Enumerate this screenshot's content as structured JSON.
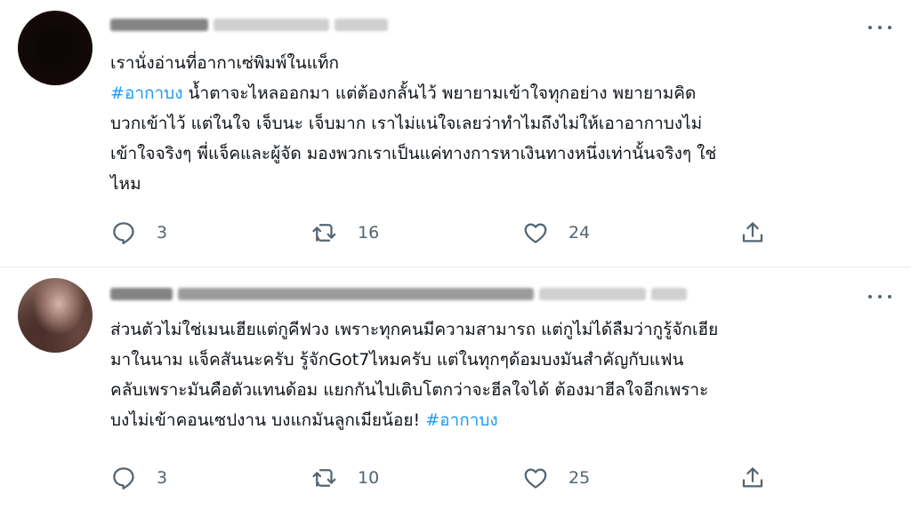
{
  "tweets": [
    {
      "text_lines": [
        [
          "เรานั่งอ่านที่อากาเซ่พิมพ์ในแท็ก"
        ],
        [
          "#อากาบง",
          " น้ำตาจะไหลออกมา แต่ต้องกลั้นไว้ พยายามเข้าใจทุกอย่าง พยายามคิด"
        ],
        [
          "บวกเข้าไว้ แต่ในใจ เจ็บนะ เจ็บมาก เราไม่แน่ใจเลยว่าทำไมถึงไม่ให้เอาอากาบงไม่"
        ],
        [
          "เข้าใจจริงๆ พี่แจ็คและผู้จัด มองพวกเราเป็นแค่ทางการหาเงินทางหนึ่งเท่านั้นจริงๆ ใช่"
        ],
        [
          "ไหม"
        ]
      ],
      "hashtag": "#อากาบง",
      "line1": "เรานั่งอ่านที่อากาเซ่พิมพ์ในแท็ก",
      "line2_rest": " น้ำตาจะไหลออกมา แต่ต้องกลั้นไว้ พยายามเข้าใจทุกอย่าง พยายามคิด",
      "line3": "บวกเข้าไว้ แต่ในใจ เจ็บนะ เจ็บมาก เราไม่แน่ใจเลยว่าทำไมถึงไม่ให้เอาอากาบงไม่",
      "line4": "เข้าใจจริงๆ พี่แจ็คและผู้จัด มองพวกเราเป็นแค่ทางการหาเงินทางหนึ่งเท่านั้นจริงๆ ใช่",
      "line5": "ไหม",
      "replies": "3",
      "retweets": "16",
      "likes": "24"
    },
    {
      "line1": "ส่วนตัวไม่ใช่เมนเฮียแต่กูคีฟวง เพราะทุกคนมีความสามารถ แต่กูไม่ได้ลืมว่ากูรู้จักเฮีย",
      "line2": "มาในนาม แจ็คสันนะครับ รู้จักGot7ไหมครับ แต่ในทุกๆด้อมบงมันสำคัญกับแฟน",
      "line3": "คลับเพราะมันคือตัวแทนด้อม แยกกันไปเติบโตกว่าจะฮีลใจได้ ต้องมาฮีลใจอีกเพราะ",
      "line4_rest": "บงไม่เข้าคอนเซปงาน บงแกมันลูกเมียน้อย! ",
      "hashtag": "#อากาบง",
      "replies": "3",
      "retweets": "10",
      "likes": "25"
    }
  ],
  "colors": {
    "text": "#0f1419",
    "hashtag": "#1d9bf0",
    "icon": "#536471",
    "divider": "#e6ecf0"
  },
  "icons": [
    "reply-icon",
    "retweet-icon",
    "like-icon",
    "share-icon",
    "more-icon"
  ]
}
